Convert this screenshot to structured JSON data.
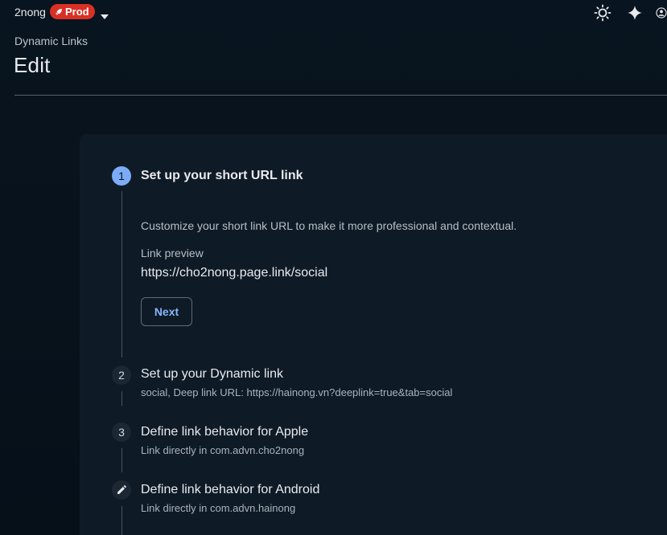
{
  "topbar": {
    "project_name": "2nong",
    "env_badge": "Prod",
    "icons": [
      "rocket-icon",
      "caret-down-icon",
      "brightness-icon",
      "sparkle-icon",
      "person-icon"
    ]
  },
  "header": {
    "breadcrumb": "Dynamic Links",
    "title": "Edit"
  },
  "steps": [
    {
      "number": "1",
      "title": "Set up your short URL link",
      "state": "active",
      "description": "Customize your short link URL to make it more professional and contextual.",
      "preview_label": "Link preview",
      "preview_url": "https://cho2nong.page.link/social",
      "next_label": "Next"
    },
    {
      "number": "2",
      "title": "Set up your Dynamic link",
      "subtitle": "social, Deep link URL: https://hainong.vn?deeplink=true&tab=social"
    },
    {
      "number": "3",
      "title": "Define link behavior for Apple",
      "subtitle": "Link directly in com.advn.cho2nong"
    },
    {
      "number": "edit-icon",
      "title": "Define link behavior for Android",
      "subtitle": "Link directly in com.advn.hainong"
    }
  ],
  "colors": {
    "background": "#06111c",
    "card": "#0e1b27",
    "accent": "#7cacf8",
    "link": "#8ab4f8",
    "badge": "#d93025"
  }
}
